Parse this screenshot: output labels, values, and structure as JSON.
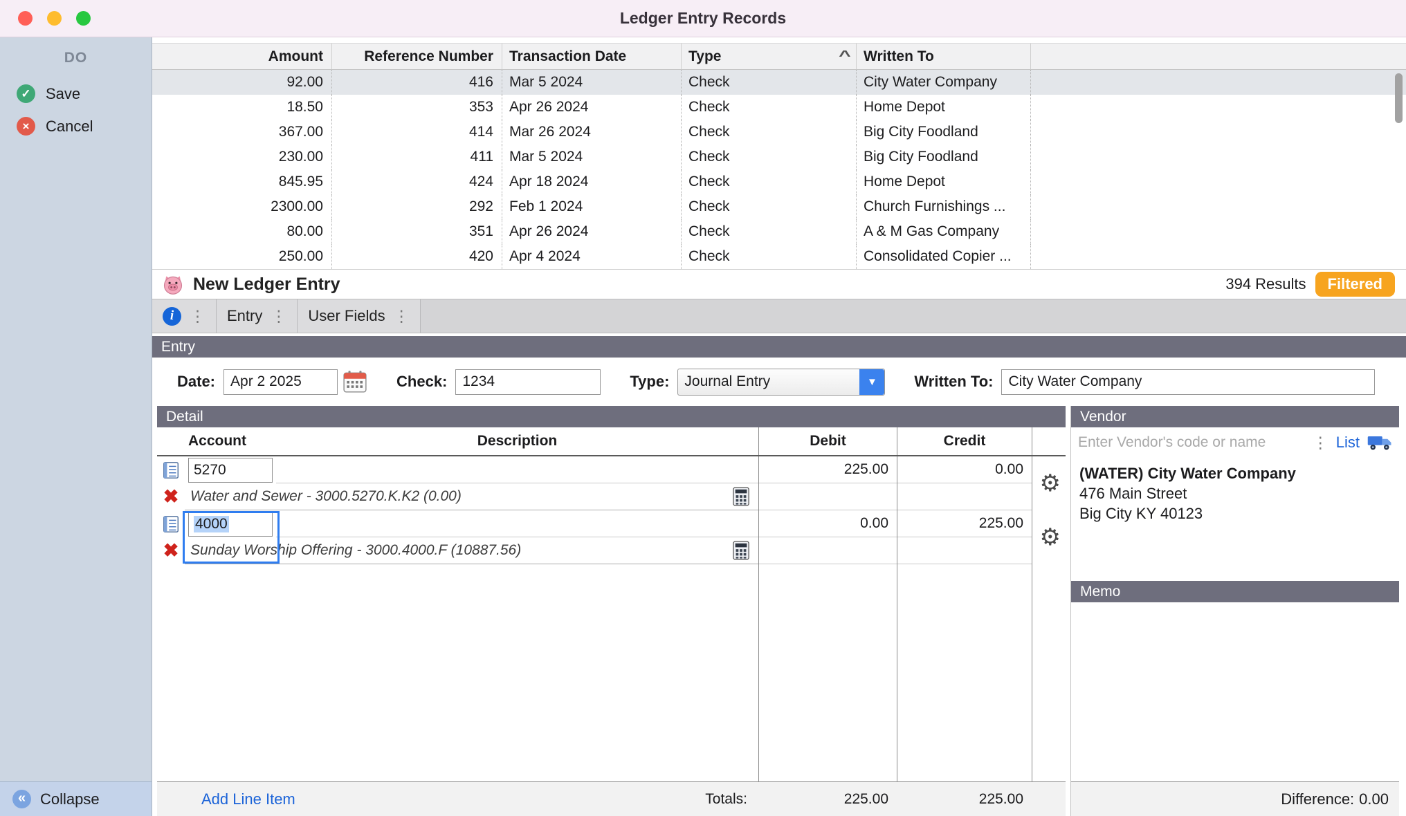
{
  "window": {
    "title": "Ledger Entry Records"
  },
  "sidebar": {
    "header": "DO",
    "save_label": "Save",
    "cancel_label": "Cancel",
    "collapse_label": "Collapse"
  },
  "records": {
    "columns": {
      "amount": "Amount",
      "ref": "Reference Number",
      "date": "Transaction Date",
      "type": "Type",
      "written_to": "Written To"
    },
    "sort_indicator": "^",
    "rows": [
      {
        "amount": "92.00",
        "ref": "416",
        "date": "Mar 5 2024",
        "type": "Check",
        "written_to": "City Water Company"
      },
      {
        "amount": "18.50",
        "ref": "353",
        "date": "Apr 26 2024",
        "type": "Check",
        "written_to": "Home Depot"
      },
      {
        "amount": "367.00",
        "ref": "414",
        "date": "Mar 26 2024",
        "type": "Check",
        "written_to": "Big City Foodland"
      },
      {
        "amount": "230.00",
        "ref": "411",
        "date": "Mar 5 2024",
        "type": "Check",
        "written_to": "Big City Foodland"
      },
      {
        "amount": "845.95",
        "ref": "424",
        "date": "Apr 18 2024",
        "type": "Check",
        "written_to": "Home Depot"
      },
      {
        "amount": "2300.00",
        "ref": "292",
        "date": "Feb 1 2024",
        "type": "Check",
        "written_to": "Church Furnishings ..."
      },
      {
        "amount": "80.00",
        "ref": "351",
        "date": "Apr 26 2024",
        "type": "Check",
        "written_to": "A & M Gas Company"
      },
      {
        "amount": "250.00",
        "ref": "420",
        "date": "Apr 4 2024",
        "type": "Check",
        "written_to": "Consolidated Copier ..."
      }
    ],
    "results_text": "394 Results",
    "filtered_label": "Filtered"
  },
  "entry_bar": {
    "title": "New Ledger Entry"
  },
  "tabs": {
    "entry": "Entry",
    "user_fields": "User Fields"
  },
  "entry_form": {
    "section_title": "Entry",
    "date_label": "Date:",
    "date_value": "Apr 2 2025",
    "check_label": "Check:",
    "check_value": "1234",
    "type_label": "Type:",
    "type_value": "Journal Entry",
    "written_to_label": "Written To:",
    "written_to_value": "City Water Company"
  },
  "detail": {
    "section_title": "Detail",
    "columns": {
      "account": "Account",
      "description": "Description",
      "debit": "Debit",
      "credit": "Credit"
    },
    "items": [
      {
        "account": "5270",
        "debit": "225.00",
        "credit": "0.00",
        "account_info": "Water and Sewer - 3000.5270.K.K2 (0.00)"
      },
      {
        "account": "4000",
        "debit": "0.00",
        "credit": "225.00",
        "account_info": "Sunday Worship Offering - 3000.4000.F (10887.56)"
      }
    ],
    "add_line_item_label": "Add Line Item",
    "totals_label": "Totals:",
    "totals_debit": "225.00",
    "totals_credit": "225.00"
  },
  "vendor": {
    "section_title": "Vendor",
    "search_placeholder": "Enter Vendor's code or name",
    "list_label": "List",
    "name": "(WATER) City Water Company",
    "address1": "476 Main Street",
    "address2": "Big City KY 40123"
  },
  "memo": {
    "section_title": "Memo"
  },
  "footer": {
    "difference_label": "Difference:",
    "difference_value": "0.00"
  },
  "icons": {
    "save_check": "✓",
    "cancel_x": "×",
    "collapse_chevrons": "«",
    "drag_dots": "⋮",
    "gear": "⚙",
    "dropdown_arrow": "▼",
    "delete_x": "✖",
    "info_letter": "i"
  },
  "colors": {
    "accent_blue": "#1b63d8",
    "filtered_orange": "#f7a41f",
    "header_slate": "#6e6e7d",
    "selection_blue": "#b5d3f9"
  }
}
